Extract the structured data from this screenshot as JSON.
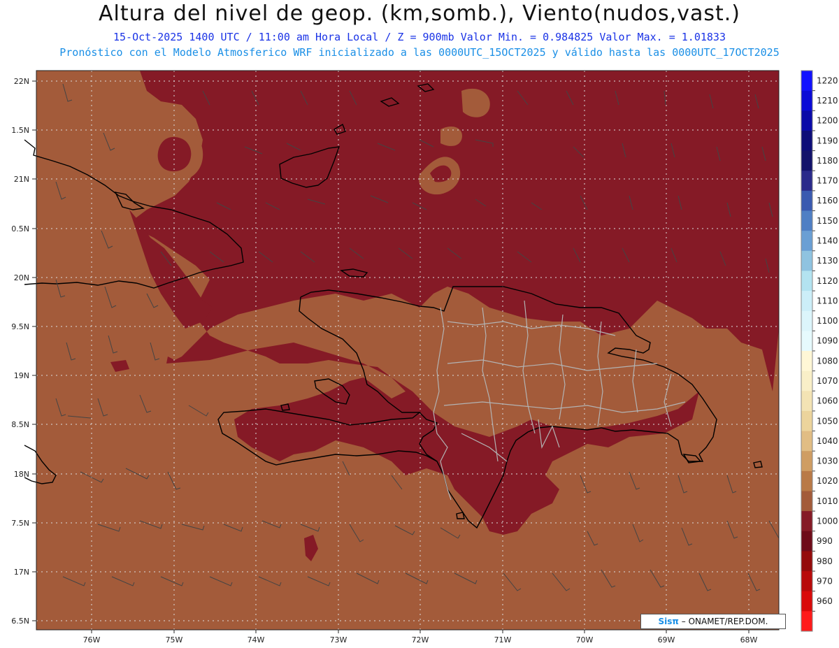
{
  "header": {
    "title": "Altura del nivel de geop. (km,somb.), Viento(nudos,vast.)",
    "subtitle": "15-Oct-2025  1400 UTC / 11:00 am Hora Local / Z = 900mb   Valor Min. = 0.984825   Valor Max. = 1.01833",
    "description": "Pronóstico con el Modelo Atmosferico WRF inicializado a las 0000UTC_15OCT2025 y válido hasta las  0000UTC_17OCT2025"
  },
  "map": {
    "lat_labels": [
      "22N",
      "1.5N",
      "21N",
      "0.5N",
      "20N",
      "9.5N",
      "19N",
      "8.5N",
      "18N",
      "7.5N",
      "17N",
      "6.5N"
    ],
    "lon_labels": [
      "76W",
      "75W",
      "74W",
      "73W",
      "72W",
      "71W",
      "70W",
      "69W",
      "68W"
    ],
    "colors": {
      "dark": "#851a26",
      "light": "#a35b3a",
      "coast": "#000000",
      "border": "#b3b3b3",
      "grid": "#dddddd"
    }
  },
  "colorbar": {
    "ticks": [
      "1220",
      "1210",
      "1200",
      "1190",
      "1180",
      "1170",
      "1160",
      "1150",
      "1140",
      "1130",
      "1120",
      "1110",
      "1100",
      "1090",
      "1080",
      "1070",
      "1060",
      "1050",
      "1040",
      "1030",
      "1020",
      "1010",
      "1000",
      "990",
      "980",
      "970",
      "960"
    ],
    "colors": [
      "#1212ff",
      "#0a0ad6",
      "#0a0aa8",
      "#0d0d78",
      "#12126a",
      "#2a2a8a",
      "#3a5ab0",
      "#4f7fc4",
      "#6a9fd4",
      "#8fc3e0",
      "#b3e3f0",
      "#cceef8",
      "#dcf5fb",
      "#e6fafd",
      "#fff7d6",
      "#f9efc8",
      "#f3e3b4",
      "#ecd49c",
      "#e1bd84",
      "#cf9d63",
      "#b97a47",
      "#a35b3a",
      "#851a26",
      "#6e0b19",
      "#940b0b",
      "#b80a0a",
      "#d90a0a",
      "#ff1a1a"
    ]
  },
  "footer": {
    "credit_brand": "Sisπ",
    "credit_text": "– ONAMET/REP.DOM."
  }
}
